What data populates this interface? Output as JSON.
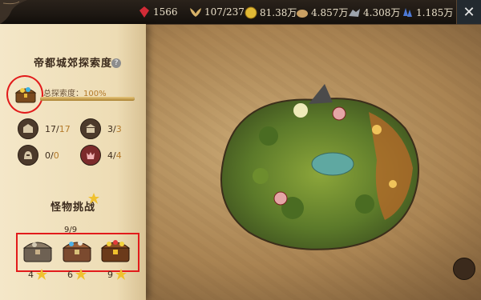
{
  "resources": [
    {
      "name": "ruby-gem",
      "value": "1566",
      "color": "#d22b36"
    },
    {
      "name": "stamina-wings",
      "value": "107/237",
      "color": "#d7b268"
    },
    {
      "name": "gold-coin",
      "value": "81.38万",
      "color": "#e1b935"
    },
    {
      "name": "food-bread",
      "value": "4.857万",
      "color": "#caa063"
    },
    {
      "name": "iron-ore",
      "value": "4.308万",
      "color": "#9ea4ac"
    },
    {
      "name": "blue-crystal",
      "value": "1.185万",
      "color": "#4d79d6"
    }
  ],
  "panel": {
    "title": "帝都城郊探索度",
    "help_symbol": "?",
    "progress_label": "总探索度：",
    "progress_value": "100%",
    "progress_fraction": 1.0,
    "stats": [
      {
        "icon": "inn-icon",
        "value": "17",
        "max": "17"
      },
      {
        "icon": "temple-icon",
        "value": "3",
        "max": "3"
      },
      {
        "icon": "helmet-icon",
        "value": "0",
        "max": "0"
      },
      {
        "icon": "monster-icon",
        "value": "4",
        "max": "4"
      }
    ],
    "monster_title": "怪物挑战",
    "monster_count": "9/9",
    "chests": [
      {
        "stars_required": "4",
        "tier": "bronze"
      },
      {
        "stars_required": "6",
        "tier": "silver"
      },
      {
        "stars_required": "9",
        "tier": "gold"
      }
    ]
  },
  "close_symbol": "✕",
  "colors": {
    "accent": "#b47a2a",
    "highlight": "#e21b1b",
    "panel": "#f0e1bd"
  }
}
